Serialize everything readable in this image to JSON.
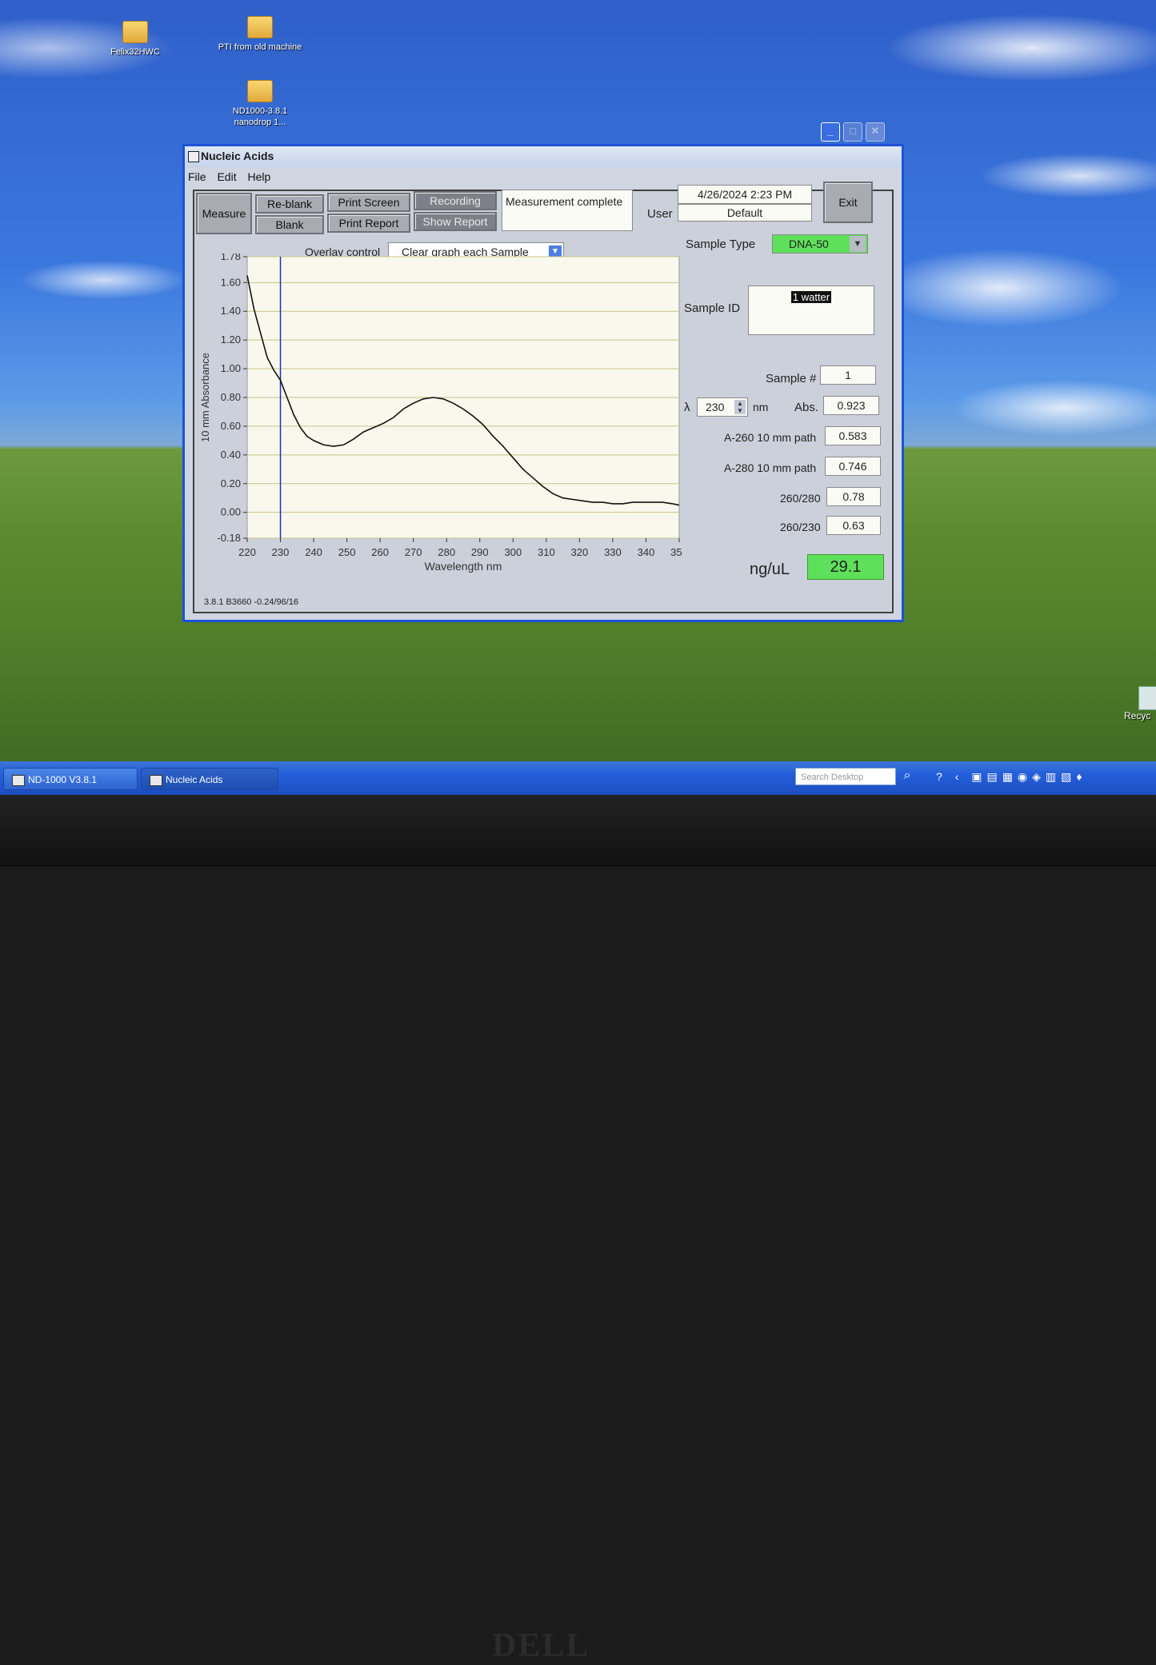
{
  "desktop": {
    "icons": [
      {
        "label": "Felix32HWC"
      },
      {
        "label": "PTI from old machine"
      },
      {
        "label": "ND1000-3.8.1 nanodrop 1..."
      }
    ],
    "recycle_label": "Recyc"
  },
  "taskbar": {
    "tasks": [
      {
        "label": "ND-1000 V3.8.1"
      },
      {
        "label": "Nucleic Acids"
      }
    ],
    "search_placeholder": "Search Desktop"
  },
  "monitor_brand": "DELL",
  "window": {
    "title": "Nucleic Acids",
    "menu": [
      "File",
      "Edit",
      "Help"
    ],
    "toolbar": {
      "measure": "Measure",
      "reblank": "Re-blank",
      "blank": "Blank",
      "print_screen": "Print Screen",
      "print_report": "Print Report",
      "recording": "Recording",
      "show_report": "Show Report",
      "status": "Measurement complete",
      "datetime": "4/26/2024  2:23 PM",
      "user_label": "User",
      "user_value": "Default",
      "exit": "Exit"
    },
    "overlay": {
      "label": "Overlay control",
      "value": "Clear graph each Sample"
    },
    "sample_type": {
      "label": "Sample Type",
      "value": "DNA-50",
      "color": "#5fe05a"
    },
    "sample_id": {
      "label": "Sample ID",
      "value": "1 watter"
    },
    "sample_num": {
      "label": "Sample #",
      "value": "1"
    },
    "lambda": {
      "symbol": "λ",
      "value": "230",
      "unit": "nm"
    },
    "abs": {
      "label": "Abs.",
      "value": "0.923"
    },
    "a260": {
      "label": "A-260 10 mm path",
      "value": "0.583"
    },
    "a280": {
      "label": "A-280 10 mm path",
      "value": "0.746"
    },
    "r260_280": {
      "label": "260/280",
      "value": "0.78"
    },
    "r260_230": {
      "label": "260/230",
      "value": "0.63"
    },
    "conc": {
      "label": "ng/uL",
      "value": "29.1",
      "color": "#5fe05a"
    },
    "version": "3.8.1 B3660 -0.24/96/16"
  },
  "chart_data": {
    "type": "line",
    "xlabel": "Wavelength nm",
    "ylabel": "10 mm Absorbance",
    "xlim": [
      220,
      350
    ],
    "ylim": [
      -0.18,
      1.78
    ],
    "xticks": [
      220,
      230,
      240,
      250,
      260,
      270,
      280,
      290,
      300,
      310,
      320,
      330,
      340,
      350
    ],
    "yticks": [
      "1.78",
      "1.60",
      "1.40",
      "1.20",
      "1.00",
      "0.80",
      "0.60",
      "0.40",
      "0.20",
      "0.00",
      "-0.18"
    ],
    "cursor_x": 230,
    "series": [
      {
        "x": [
          220,
          222,
          224,
          226,
          228,
          230,
          232,
          234,
          236,
          238,
          240,
          243,
          246,
          249,
          252,
          255,
          258,
          261,
          264,
          267,
          270,
          273,
          276,
          279,
          282,
          285,
          288,
          291,
          294,
          297,
          300,
          303,
          306,
          309,
          312,
          315,
          318,
          321,
          324,
          327,
          330,
          333,
          336,
          339,
          342,
          345,
          348,
          350
        ],
        "y": [
          1.65,
          1.42,
          1.25,
          1.08,
          0.99,
          0.92,
          0.8,
          0.68,
          0.59,
          0.53,
          0.5,
          0.47,
          0.46,
          0.47,
          0.51,
          0.56,
          0.59,
          0.62,
          0.66,
          0.72,
          0.76,
          0.79,
          0.8,
          0.79,
          0.76,
          0.72,
          0.67,
          0.61,
          0.53,
          0.46,
          0.38,
          0.3,
          0.24,
          0.18,
          0.13,
          0.1,
          0.09,
          0.08,
          0.07,
          0.07,
          0.06,
          0.06,
          0.07,
          0.07,
          0.07,
          0.07,
          0.06,
          0.05
        ]
      }
    ]
  }
}
